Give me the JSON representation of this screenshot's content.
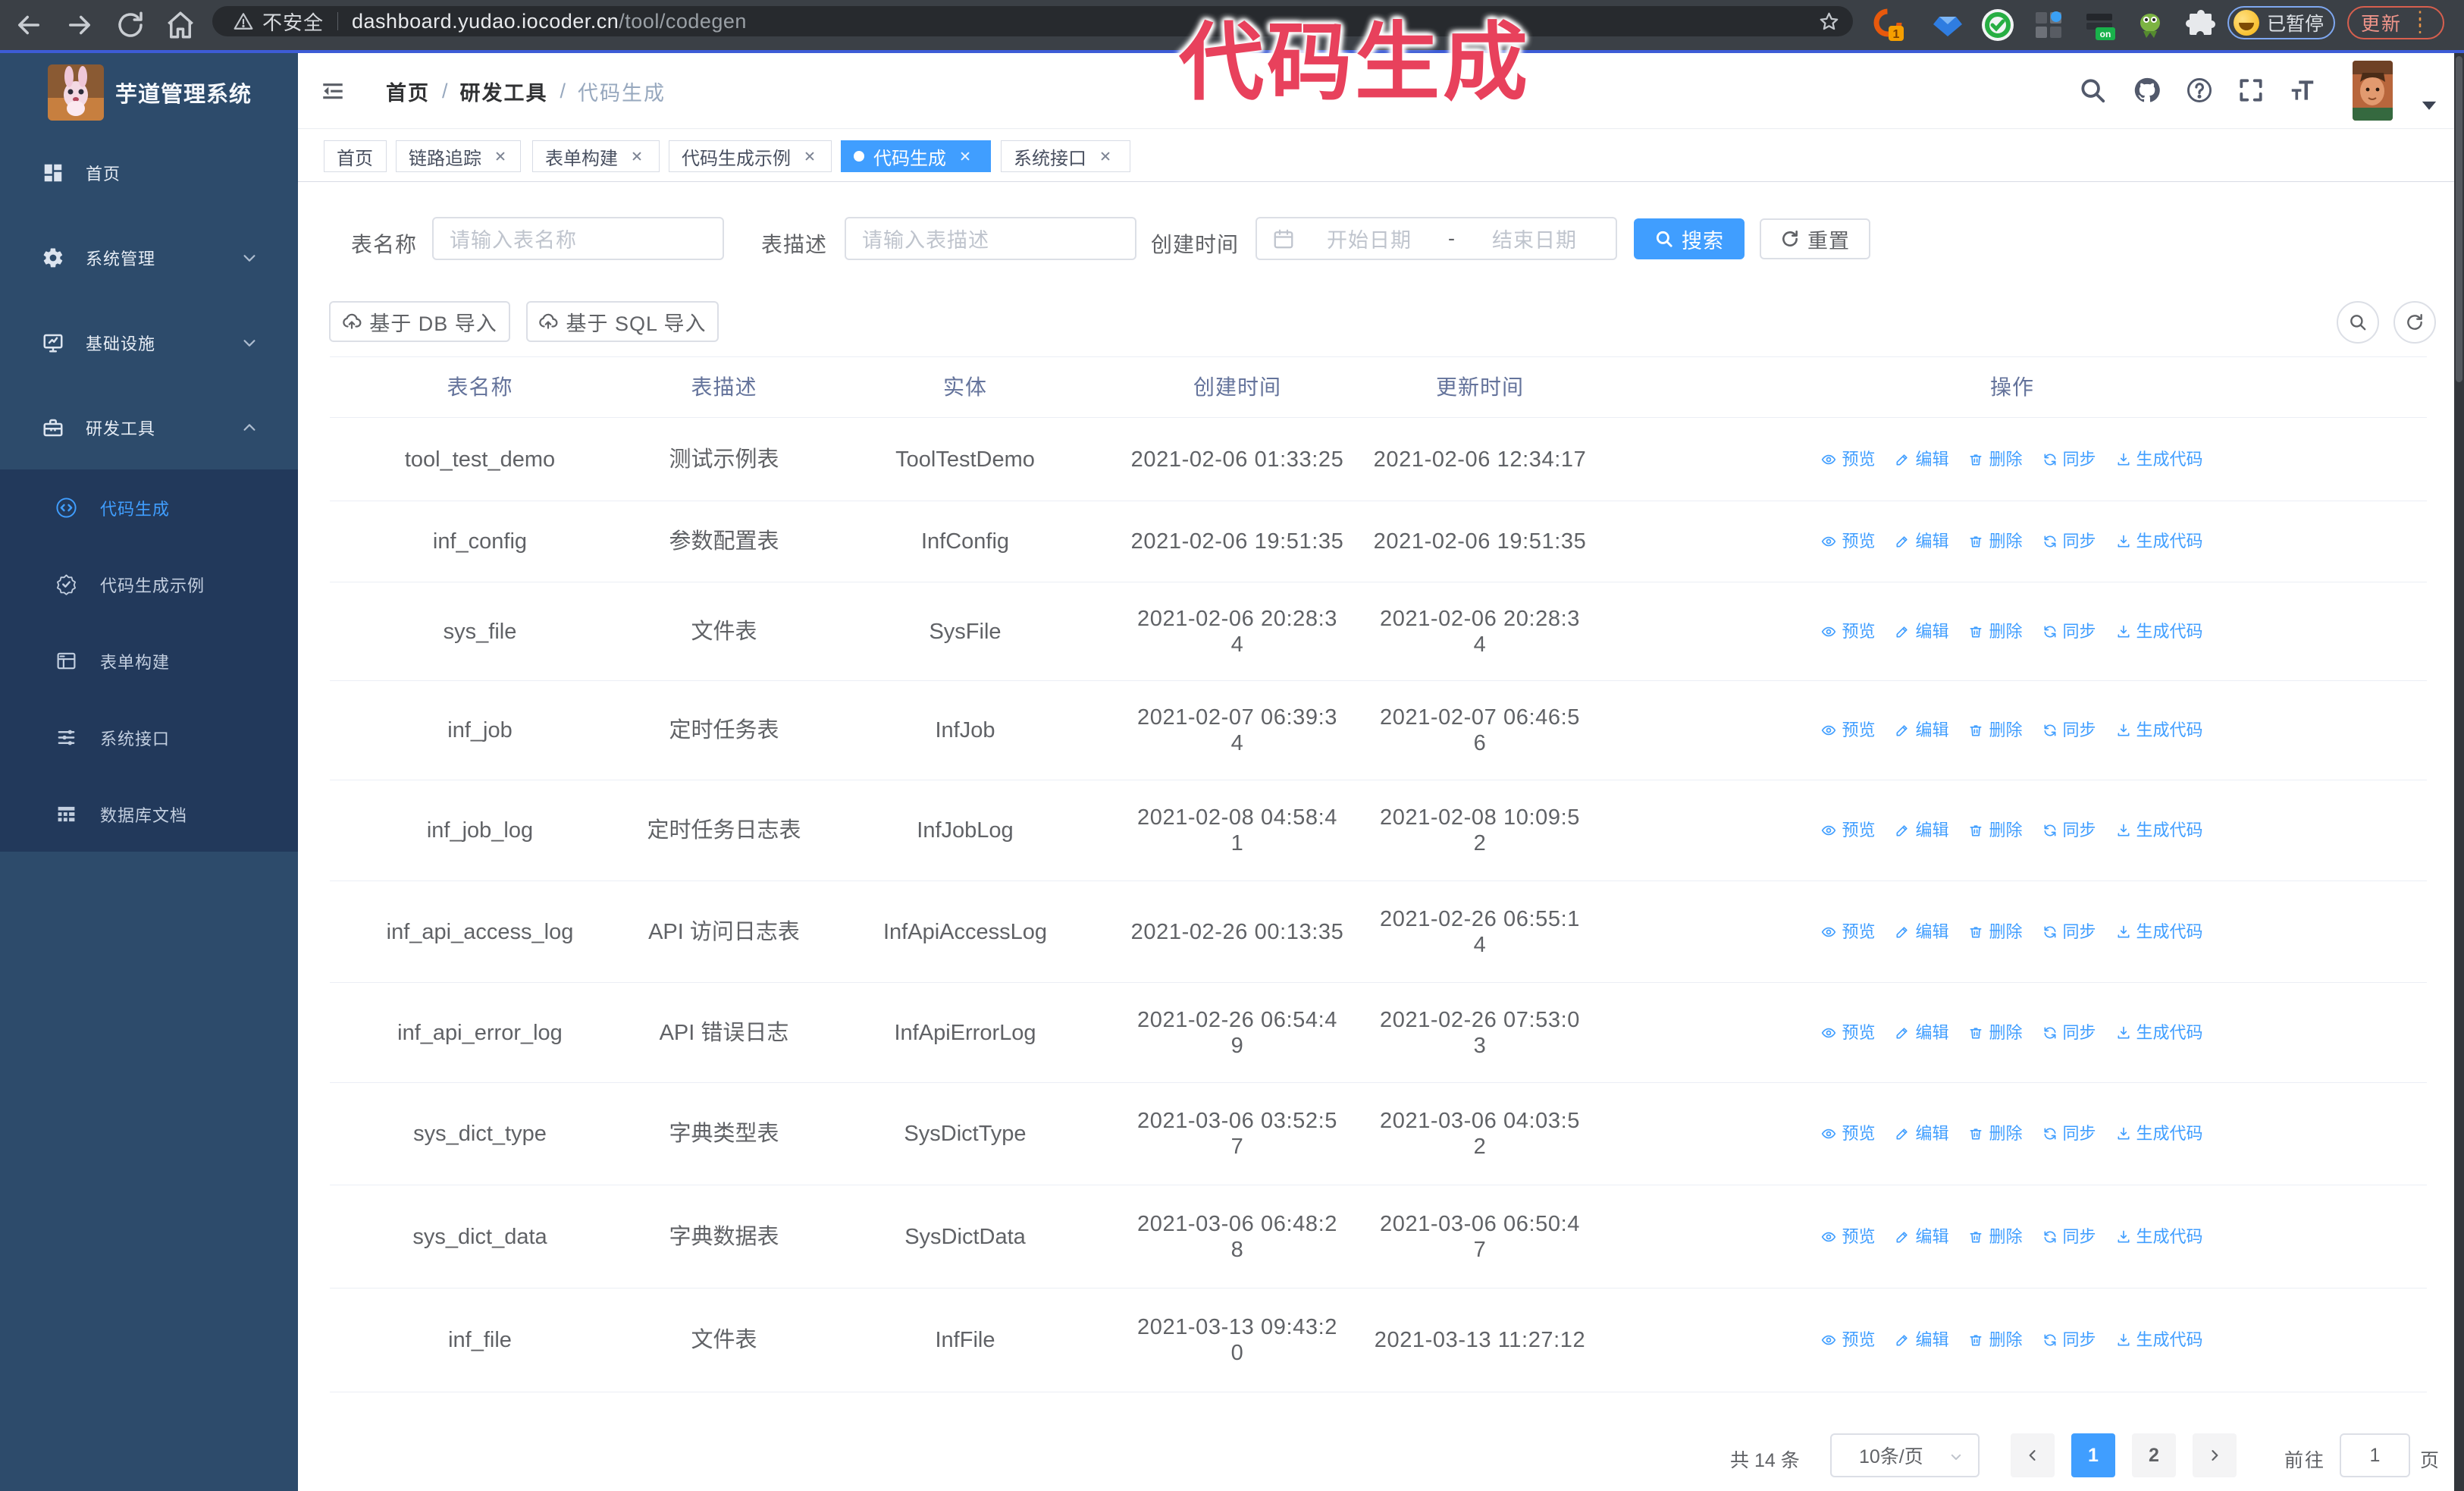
{
  "browser": {
    "security_label": "不安全",
    "url_domain": "dashboard.yudao.iocoder.cn",
    "url_path": "/tool/codegen",
    "extension_badge": "1",
    "extension_on_badge": "on",
    "paused_label": "已暂停",
    "update_label": "更新"
  },
  "annotation": {
    "text": "代码生成",
    "color": "#e8415c"
  },
  "sidebar": {
    "title": "芋道管理系统",
    "items": [
      {
        "label": "首页"
      },
      {
        "label": "系统管理"
      },
      {
        "label": "基础设施"
      },
      {
        "label": "研发工具"
      }
    ],
    "submenu": [
      {
        "label": "代码生成",
        "active": true
      },
      {
        "label": "代码生成示例",
        "active": false
      },
      {
        "label": "表单构建",
        "active": false
      },
      {
        "label": "系统接口",
        "active": false
      },
      {
        "label": "数据库文档",
        "active": false
      }
    ]
  },
  "breadcrumb": [
    "首页",
    "研发工具",
    "代码生成"
  ],
  "tabs": [
    {
      "label": "首页",
      "closable": false,
      "active": false
    },
    {
      "label": "链路追踪",
      "closable": true,
      "active": false
    },
    {
      "label": "表单构建",
      "closable": true,
      "active": false
    },
    {
      "label": "代码生成示例",
      "closable": true,
      "active": false
    },
    {
      "label": "代码生成",
      "closable": true,
      "active": true
    },
    {
      "label": "系统接口",
      "closable": true,
      "active": false
    }
  ],
  "filters": {
    "table_name_label": "表名称",
    "table_name_placeholder": "请输入表名称",
    "table_desc_label": "表描述",
    "table_desc_placeholder": "请输入表描述",
    "create_time_label": "创建时间",
    "date_start_placeholder": "开始日期",
    "date_separator": "-",
    "date_end_placeholder": "结束日期",
    "search_label": "搜索",
    "reset_label": "重置"
  },
  "toolbar": {
    "import_db_label": "基于 DB 导入",
    "import_sql_label": "基于 SQL 导入"
  },
  "table": {
    "columns": [
      "表名称",
      "表描述",
      "实体",
      "创建时间",
      "更新时间",
      "操作"
    ],
    "actions": [
      "预览",
      "编辑",
      "删除",
      "同步",
      "生成代码"
    ],
    "rows": [
      {
        "name": "tool_test_demo",
        "desc": "测试示例表",
        "entity": "ToolTestDemo",
        "create_time": "2021-02-06 01:33:25",
        "update_time": "2021-02-06 12:34:17",
        "create_wrapped": false,
        "update_wrapped": false
      },
      {
        "name": "inf_config",
        "desc": "参数配置表",
        "entity": "InfConfig",
        "create_time": "2021-02-06 19:51:35",
        "update_time": "2021-02-06 19:51:35",
        "create_wrapped": false,
        "update_wrapped": false
      },
      {
        "name": "sys_file",
        "desc": "文件表",
        "entity": "SysFile",
        "create_time": "2021-02-06 20:28:34",
        "update_time": "2021-02-06 20:28:34",
        "create_wrapped": true,
        "update_wrapped": true
      },
      {
        "name": "inf_job",
        "desc": "定时任务表",
        "entity": "InfJob",
        "create_time": "2021-02-07 06:39:34",
        "update_time": "2021-02-07 06:46:56",
        "create_wrapped": true,
        "update_wrapped": true
      },
      {
        "name": "inf_job_log",
        "desc": "定时任务日志表",
        "entity": "InfJobLog",
        "create_time": "2021-02-08 04:58:41",
        "update_time": "2021-02-08 10:09:52",
        "create_wrapped": true,
        "update_wrapped": true
      },
      {
        "name": "inf_api_access_log",
        "desc": "API 访问日志表",
        "entity": "InfApiAccessLog",
        "create_time": "2021-02-26 00:13:35",
        "update_time": "2021-02-26 06:55:14",
        "create_wrapped": false,
        "update_wrapped": true
      },
      {
        "name": "inf_api_error_log",
        "desc": "API 错误日志",
        "entity": "InfApiErrorLog",
        "create_time": "2021-02-26 06:54:49",
        "update_time": "2021-02-26 07:53:03",
        "create_wrapped": true,
        "update_wrapped": true
      },
      {
        "name": "sys_dict_type",
        "desc": "字典类型表",
        "entity": "SysDictType",
        "create_time": "2021-03-06 03:52:57",
        "update_time": "2021-03-06 04:03:52",
        "create_wrapped": true,
        "update_wrapped": true
      },
      {
        "name": "sys_dict_data",
        "desc": "字典数据表",
        "entity": "SysDictData",
        "create_time": "2021-03-06 06:48:28",
        "update_time": "2021-03-06 06:50:47",
        "create_wrapped": true,
        "update_wrapped": true
      },
      {
        "name": "inf_file",
        "desc": "文件表",
        "entity": "InfFile",
        "create_time": "2021-03-13 09:43:20",
        "update_time": "2021-03-13 11:27:12",
        "create_wrapped": true,
        "update_wrapped": false
      }
    ]
  },
  "pagination": {
    "total_label": "共 14 条",
    "page_size_label": "10条/页",
    "pages": [
      "1",
      "2"
    ],
    "active_page": "1",
    "goto_label": "前往",
    "goto_value": "1",
    "unit_label": "页"
  }
}
